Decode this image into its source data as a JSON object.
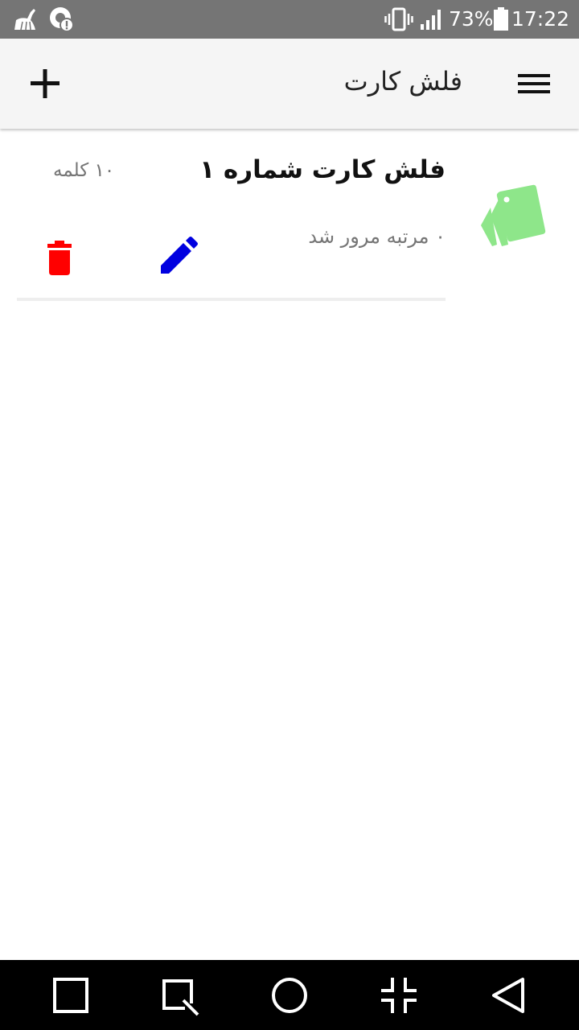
{
  "status_bar": {
    "battery": "73%",
    "time": "17:22",
    "icons": [
      "cleaner-icon",
      "notification-icon",
      "vibrate-icon",
      "signal-icon",
      "battery-icon"
    ]
  },
  "app_bar": {
    "title": "فلش کارت",
    "add_icon": "plus-icon",
    "menu_icon": "hamburger-menu-icon"
  },
  "decks": [
    {
      "title": "فلش کارت شماره ۱",
      "word_count": "۱۰ کلمه",
      "reviews": "۰ مرتبه مرور شد",
      "icon": "cards-icon",
      "icon_color": "#8ee68a",
      "edit_icon": "pencil-icon",
      "edit_color": "#0000e0",
      "delete_icon": "trash-icon",
      "delete_color": "#ff0000"
    }
  ],
  "nav_bar": {
    "buttons": [
      "recent-apps-icon",
      "screenshot-icon",
      "home-icon",
      "shrink-icon",
      "back-icon"
    ]
  }
}
